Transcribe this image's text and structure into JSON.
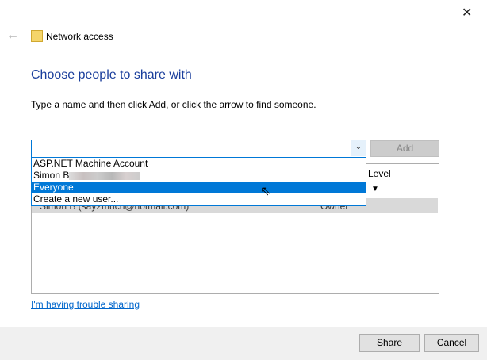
{
  "window": {
    "title": "Network access",
    "close_icon": "close-icon",
    "back_icon": "back-arrow-icon"
  },
  "heading": "Choose people to share with",
  "instruction": "Type a name and then click Add, or click the arrow to find someone.",
  "combo": {
    "value": "",
    "add_label": "Add"
  },
  "dropdown": {
    "items": [
      "ASP.NET Machine Account",
      "Simon B",
      "Everyone",
      "Create a new user..."
    ],
    "selected": "Everyone"
  },
  "table": {
    "header_level": "Level",
    "rows": [
      {
        "name": "Simon B (say2much@hotmail.com)",
        "permission": "Owner"
      }
    ]
  },
  "trouble_link": "I'm having trouble sharing",
  "buttons": {
    "share": "Share",
    "cancel": "Cancel"
  }
}
